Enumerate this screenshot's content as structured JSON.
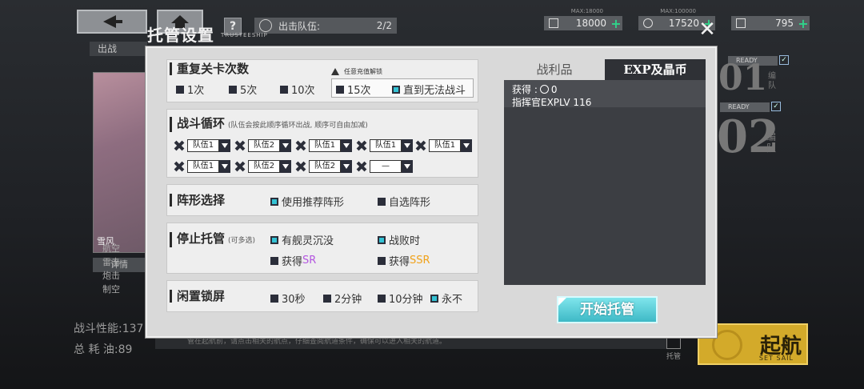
{
  "background": {
    "help_label": "?",
    "sortie": {
      "label": "出击队伍:",
      "count": "2/2"
    },
    "resources": [
      {
        "max": "MAX:18000",
        "value": "18000"
      },
      {
        "max": "MAX:100000",
        "value": "17520"
      },
      {
        "max": "",
        "value": "795"
      }
    ],
    "left_tab": "出战",
    "ship_name": "雪风",
    "detail_label": "详情",
    "side_labels": [
      "航空",
      "雷击",
      "炮击",
      "制空"
    ],
    "power_label": "战斗性能:137",
    "fuel_label": "总 耗 油:89",
    "bottom_tip": "管在起航前，请点击相关的航点，仔细查阅航道条件，确保可以进入相关的航道。",
    "ready_label": "READY",
    "team_numbers": [
      "01",
      "02"
    ],
    "team_label": "编队",
    "go_main": "起航",
    "go_sub": "SET SAIL",
    "tuoguan_small": "托管"
  },
  "dialog": {
    "title": "托管设置",
    "subtitle": "TRUSTEESHIP",
    "close_glyph": "✕",
    "repeat": {
      "title": "重复关卡次数",
      "hint": "任意充值解锁",
      "options": [
        {
          "label": "1次",
          "checked": false
        },
        {
          "label": "5次",
          "checked": false
        },
        {
          "label": "10次",
          "checked": false
        },
        {
          "label": "15次",
          "checked": false
        },
        {
          "label": "直到无法战斗",
          "checked": true
        }
      ]
    },
    "cycle": {
      "title": "战斗循环",
      "note": "(队伍会按此顺序循环出战, 顺序可自由加减)",
      "row1": [
        "队伍1",
        "队伍2",
        "队伍1",
        "队伍1",
        "队伍1"
      ],
      "row2": [
        "队伍1",
        "队伍2",
        "队伍2",
        "—"
      ]
    },
    "formation": {
      "title": "阵形选择",
      "options": [
        {
          "label": "使用推荐阵形",
          "checked": true
        },
        {
          "label": "自选阵形",
          "checked": false
        }
      ]
    },
    "stop": {
      "title": "停止托管",
      "note": "(可多选)",
      "opt1": "有舰灵沉没",
      "opt2": "战败时",
      "opt3_prefix": "获得",
      "opt3_rarity": "SR",
      "opt4_prefix": "获得",
      "opt4_rarity": "SSR"
    },
    "idle": {
      "title": "闲置锁屏",
      "options": [
        {
          "label": "30秒",
          "checked": false
        },
        {
          "label": "2分钟",
          "checked": false
        },
        {
          "label": "10分钟",
          "checked": false
        },
        {
          "label": "永不",
          "checked": true
        }
      ]
    },
    "tabs": {
      "loot": "战利品",
      "exp": "EXP及晶币"
    },
    "reward": {
      "gain_label": "获得 :",
      "gain_value": "0",
      "exp_line": "指挥官EXPLV 116"
    },
    "start_button": "开始托管"
  }
}
